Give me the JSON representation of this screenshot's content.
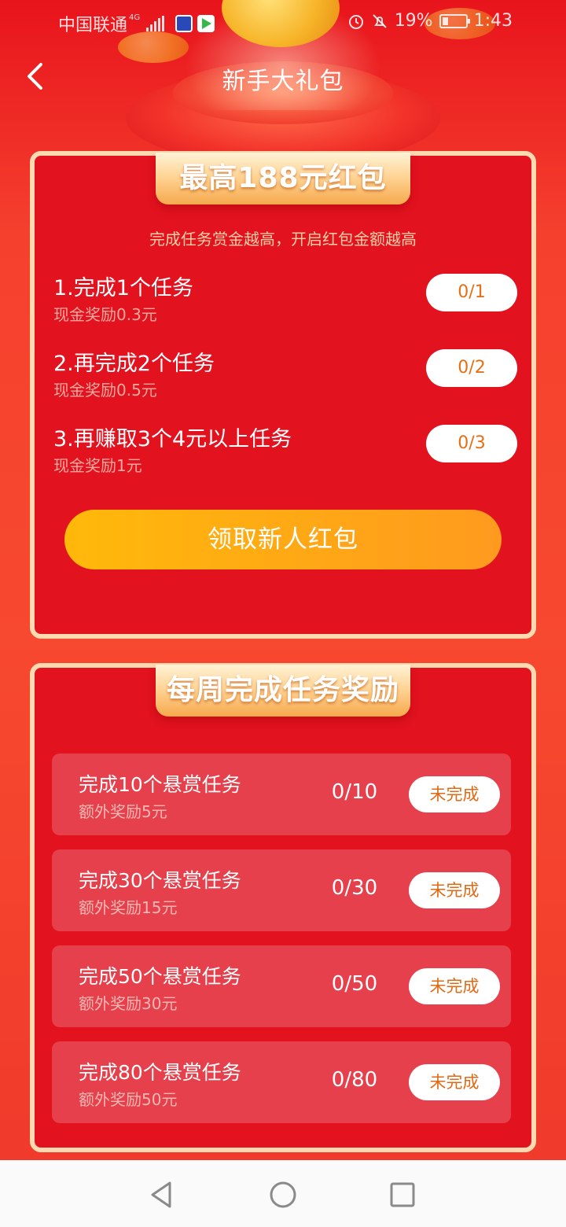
{
  "status_bar": {
    "carrier": "中国联通",
    "network": "4G",
    "battery": "19%",
    "time": "1:43"
  },
  "nav": {
    "title": "新手大礼包"
  },
  "newbie": {
    "ribbon": "最高188元红包",
    "subtitle": "完成任务赏金越高，开启红包金额越高",
    "tasks": [
      {
        "title": "1.完成1个任务",
        "reward": "现金奖励0.3元",
        "progress": "0/1"
      },
      {
        "title": "2.再完成2个任务",
        "reward": "现金奖励0.5元",
        "progress": "0/2"
      },
      {
        "title": "3.再赚取3个4元以上任务",
        "reward": "现金奖励1元",
        "progress": "0/3"
      }
    ],
    "claim_button": "领取新人红包"
  },
  "weekly": {
    "ribbon": "每周完成任务奖励",
    "items": [
      {
        "title": "完成10个悬赏任务",
        "reward": "额外奖励5元",
        "progress": "0/10",
        "status": "未完成"
      },
      {
        "title": "完成30个悬赏任务",
        "reward": "额外奖励15元",
        "progress": "0/30",
        "status": "未完成"
      },
      {
        "title": "完成50个悬赏任务",
        "reward": "额外奖励30元",
        "progress": "0/50",
        "status": "未完成"
      },
      {
        "title": "完成80个悬赏任务",
        "reward": "额外奖励50元",
        "progress": "0/80",
        "status": "未完成"
      }
    ]
  },
  "colors": {
    "primary_red": "#e2121f",
    "card_border": "#ffd9b0",
    "accent_orange": "#ff9a1f"
  },
  "icons": {
    "back": "chevron-left-icon",
    "sys_back": "triangle-back-icon",
    "sys_home": "circle-home-icon",
    "sys_recent": "square-recent-icon"
  }
}
